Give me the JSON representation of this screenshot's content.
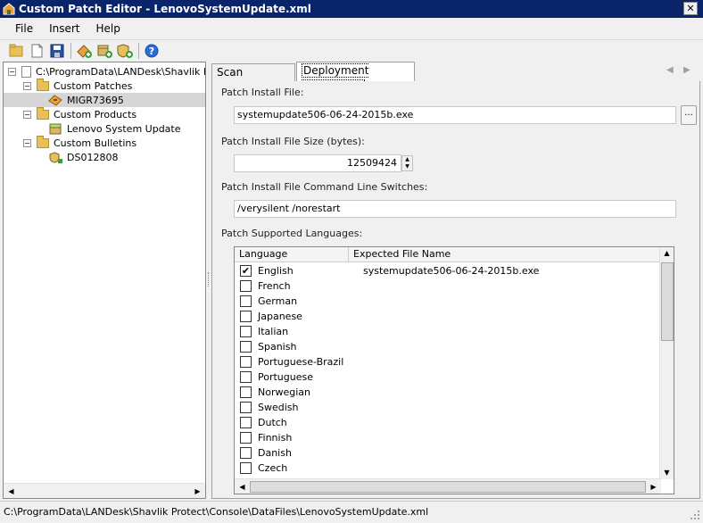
{
  "window": {
    "title": "Custom Patch Editor - LenovoSystemUpdate.xml",
    "close_glyph": "✕"
  },
  "menu": {
    "items": [
      "File",
      "Insert",
      "Help"
    ]
  },
  "toolbar": {
    "icons": [
      "open-folder-icon",
      "new-document-icon",
      "save-icon",
      "add-patch-icon",
      "add-product-icon",
      "add-bulletin-icon",
      "help-icon"
    ],
    "help_glyph": "?"
  },
  "tree": {
    "root": "C:\\ProgramData\\LANDesk\\Shavlik Protect\\Console\\DataFiles\\LenovoSystemUpdate.xml",
    "patches_label": "Custom Patches",
    "patch_item": "MIGR73695",
    "products_label": "Custom Products",
    "product_item": "Lenovo System Update",
    "bulletins_label": "Custom Bulletins",
    "bulletin_item": "DS012808",
    "expanded_glyph": "−"
  },
  "tabs": [
    "Scan Information",
    "Deployment Information"
  ],
  "deploy": {
    "install_file_label": "Patch Install File:",
    "install_file_value": "systemupdate506-06-24-2015b.exe",
    "browse_label": "...",
    "size_label": "Patch Install File Size (bytes):",
    "size_value": "12509424",
    "switches_label": "Patch Install File Command Line Switches:",
    "switches_value": "/verysilent /norestart",
    "languages_label": "Patch Supported Languages:"
  },
  "grid": {
    "col_language": "Language",
    "col_filename": "Expected File Name",
    "rows": [
      {
        "language": "English",
        "checked": true,
        "file": "systemupdate506-06-24-2015b.exe"
      },
      {
        "language": "French",
        "checked": false,
        "file": ""
      },
      {
        "language": "German",
        "checked": false,
        "file": ""
      },
      {
        "language": "Japanese",
        "checked": false,
        "file": ""
      },
      {
        "language": "Italian",
        "checked": false,
        "file": ""
      },
      {
        "language": "Spanish",
        "checked": false,
        "file": ""
      },
      {
        "language": "Portuguese-Brazil",
        "checked": false,
        "file": ""
      },
      {
        "language": "Portuguese",
        "checked": false,
        "file": ""
      },
      {
        "language": "Norwegian",
        "checked": false,
        "file": ""
      },
      {
        "language": "Swedish",
        "checked": false,
        "file": ""
      },
      {
        "language": "Dutch",
        "checked": false,
        "file": ""
      },
      {
        "language": "Finnish",
        "checked": false,
        "file": ""
      },
      {
        "language": "Danish",
        "checked": false,
        "file": ""
      },
      {
        "language": "Czech",
        "checked": false,
        "file": ""
      }
    ],
    "check_glyph": "✔"
  },
  "status": {
    "text": "C:\\ProgramData\\LANDesk\\Shavlik Protect\\Console\\DataFiles\\LenovoSystemUpdate.xml"
  },
  "colors": {
    "title_bar": "#0a246a",
    "selection": "#d6d6d6"
  }
}
